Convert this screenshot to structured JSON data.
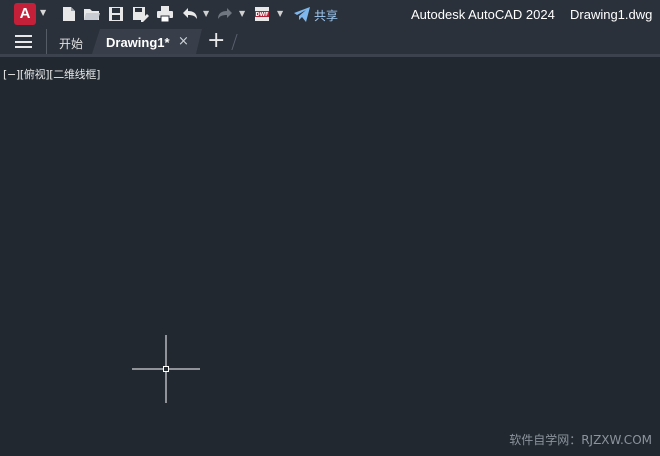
{
  "titlebar": {
    "app_letter": "A",
    "share_label": "共享",
    "app_title": "Autodesk AutoCAD 2024",
    "document_title": "Drawing1.dwg"
  },
  "quick_access": {
    "icons": [
      "new-file-icon",
      "open-folder-icon",
      "save-icon",
      "save-as-icon",
      "plot-icon",
      "undo-icon",
      "redo-icon",
      "dwf-publish-icon",
      "share-icon"
    ]
  },
  "tabs": {
    "start_label": "开始",
    "drawing_label": "Drawing1*",
    "close_glyph": "×",
    "add_glyph": "+"
  },
  "viewport": {
    "control_label": "[−][俯视][二维线框]",
    "watermark": "软件自学网：RJZXW.COM"
  },
  "colors": {
    "background": "#212830",
    "toolbar": "#2b313b",
    "active_tab": "#383f4a",
    "app_icon": "#c4203a",
    "share_accent": "#7fb8ee"
  }
}
